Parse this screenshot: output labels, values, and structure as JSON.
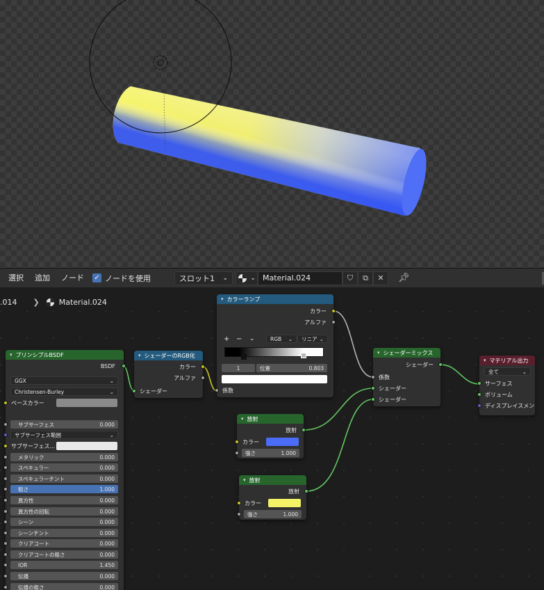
{
  "header": {
    "menu": [
      "選択",
      "追加",
      "ノード"
    ],
    "use_nodes_label": "ノードを使用",
    "slot": "スロット1",
    "material": "Material.024"
  },
  "breadcrumb": {
    "object": ".014",
    "material": "Material.024"
  },
  "nodes": {
    "bsdf": {
      "title": "プリンシプルBSDF",
      "output": "BSDF",
      "distribution": "GGX",
      "subsurface_method": "Christensen-Burley",
      "base_color_label": "ベースカラー",
      "subsurface_radius_label": "サブサーフェス範囲",
      "subsurface_color_label": "サブサーフェス...",
      "fields": [
        {
          "label": "サブサーフェス",
          "value": "0.000"
        },
        {
          "label": "メタリック",
          "value": "0.000"
        },
        {
          "label": "スペキュラー",
          "value": "0.000"
        },
        {
          "label": "スペキュラーチント",
          "value": "0.000"
        },
        {
          "label": "粗さ",
          "value": "1.000"
        },
        {
          "label": "異方性",
          "value": "0.000"
        },
        {
          "label": "異方性の回転",
          "value": "0.000"
        },
        {
          "label": "シーン",
          "value": "0.000"
        },
        {
          "label": "シーンチント",
          "value": "0.000"
        },
        {
          "label": "クリアコート",
          "value": "0.000"
        },
        {
          "label": "クリアコートの粗さ",
          "value": "0.000"
        },
        {
          "label": "IOR",
          "value": "1.450"
        },
        {
          "label": "伝播",
          "value": "0.000"
        },
        {
          "label": "伝播の粗さ",
          "value": "0.000"
        }
      ],
      "base_color": "#8a8a8a",
      "subsurface_color": "#e8e8e8"
    },
    "shader_to_rgb": {
      "title": "シェーダーのRGB化",
      "out_color": "カラー",
      "out_alpha": "アルファ",
      "in_shader": "シェーダー"
    },
    "color_ramp": {
      "title": "カラーランプ",
      "out_color": "カラー",
      "out_alpha": "アルファ",
      "plus": "+",
      "minus": "−",
      "mode": "RGB",
      "interp": "リニア",
      "stop_index": "1",
      "pos_label": "位置",
      "pos_value": "0.803",
      "in_fac": "係数",
      "stop_color": "#ffffff"
    },
    "emission1": {
      "title": "放射",
      "output": "放射",
      "color_label": "カラー",
      "strength_label": "強さ",
      "strength": "1.000",
      "color": "#4a6cf7"
    },
    "emission2": {
      "title": "放射",
      "output": "放射",
      "color_label": "カラー",
      "strength_label": "強さ",
      "strength": "1.000",
      "color": "#f4f267"
    },
    "mix_shader": {
      "title": "シェーダーミックス",
      "output": "シェーダー",
      "in_fac": "係数",
      "in_shader1": "シェーダー",
      "in_shader2": "シェーダー"
    },
    "output": {
      "title": "マテリアル出力",
      "target": "全て",
      "surface": "サーフェス",
      "volume": "ボリューム",
      "displacement": "ディスプレイスメン"
    }
  }
}
